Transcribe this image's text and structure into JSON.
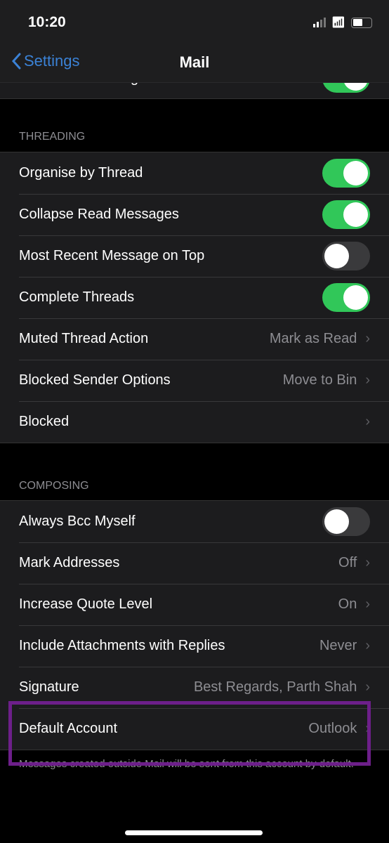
{
  "status": {
    "time": "10:20"
  },
  "nav": {
    "back_label": "Settings",
    "title": "Mail"
  },
  "partial_row": {
    "label": "Load Remote Images",
    "on": true
  },
  "threading": {
    "header": "THREADING",
    "rows": [
      {
        "label": "Organise by Thread",
        "toggle": true
      },
      {
        "label": "Collapse Read Messages",
        "toggle": true
      },
      {
        "label": "Most Recent Message on Top",
        "toggle": false
      },
      {
        "label": "Complete Threads",
        "toggle": true
      },
      {
        "label": "Muted Thread Action",
        "value": "Mark as Read"
      },
      {
        "label": "Blocked Sender Options",
        "value": "Move to Bin"
      },
      {
        "label": "Blocked",
        "value": ""
      }
    ]
  },
  "composing": {
    "header": "COMPOSING",
    "rows": [
      {
        "label": "Always Bcc Myself",
        "toggle": false
      },
      {
        "label": "Mark Addresses",
        "value": "Off"
      },
      {
        "label": "Increase Quote Level",
        "value": "On"
      },
      {
        "label": "Include Attachments with Replies",
        "value": "Never"
      },
      {
        "label": "Signature",
        "value": "Best Regards, Parth Shah"
      },
      {
        "label": "Default Account",
        "value": "Outlook"
      }
    ],
    "footer": "Messages created outside Mail will be sent from this account by default."
  },
  "colors": {
    "accent": "#3b82d6",
    "toggle_on": "#31c759",
    "highlight": "#6d1f8a"
  }
}
